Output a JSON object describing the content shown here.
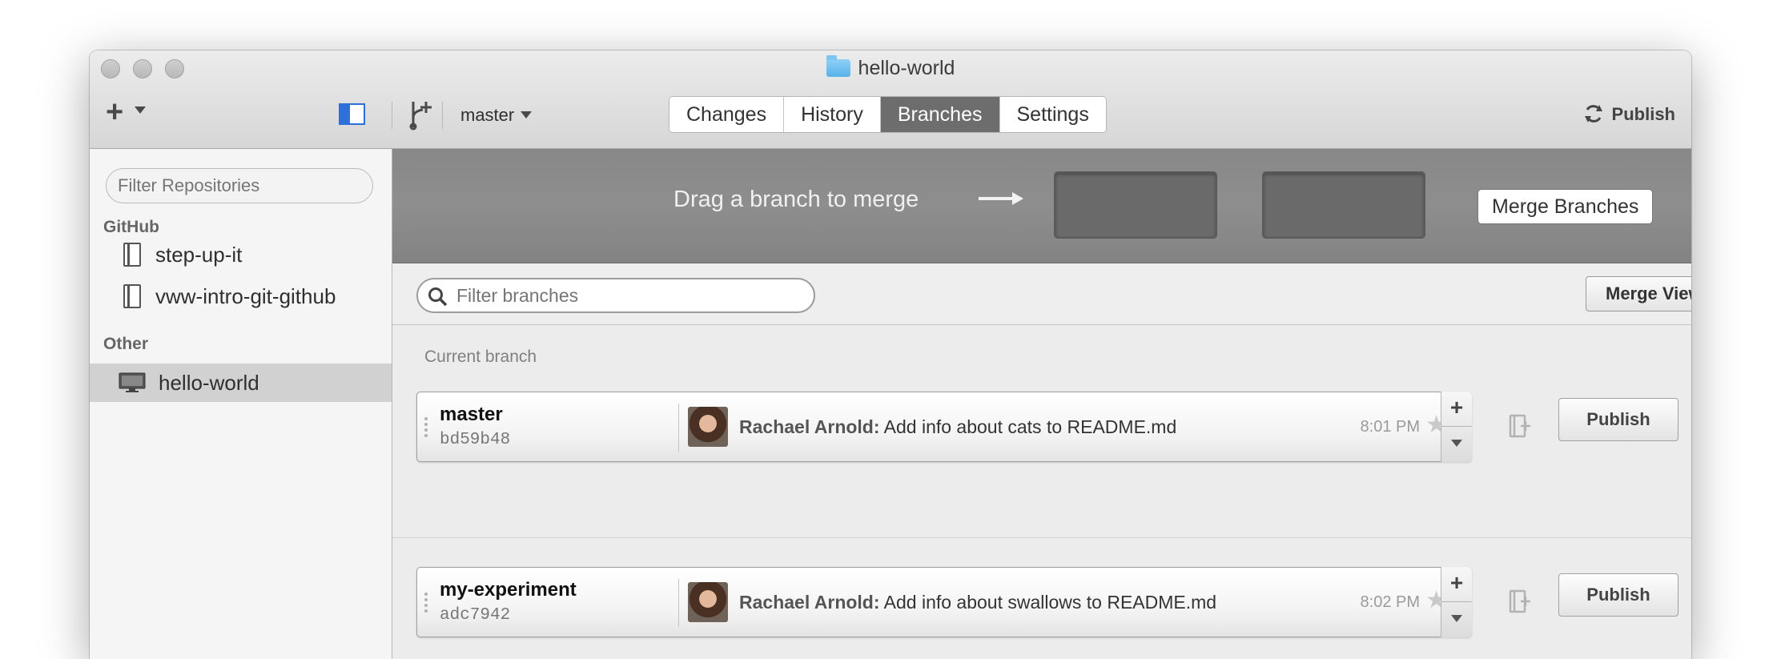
{
  "window": {
    "title": "hello-world"
  },
  "toolbar": {
    "branch_name": "master",
    "tabs": [
      {
        "label": "Changes",
        "active": false
      },
      {
        "label": "History",
        "active": false
      },
      {
        "label": "Branches",
        "active": true
      },
      {
        "label": "Settings",
        "active": false
      }
    ],
    "publish_label": "Publish"
  },
  "sidebar": {
    "filter_placeholder": "Filter Repositories",
    "groups": [
      {
        "label": "GitHub",
        "items": [
          "step-up-it",
          "vww-intro-git-github"
        ]
      },
      {
        "label": "Other",
        "items": [
          "hello-world"
        ]
      }
    ],
    "selected": "hello-world"
  },
  "merge": {
    "hint": "Drag a branch to merge",
    "button_label": "Merge Branches"
  },
  "branches": {
    "filter_placeholder": "Filter branches",
    "merge_view_label": "Merge View",
    "current_section_label": "Current branch",
    "rows": [
      {
        "name": "master",
        "sha": "bd59b48",
        "author": "Rachael Arnold:",
        "message": "Add info about cats to README.md",
        "time": "8:01 PM",
        "publish_label": "Publish"
      },
      {
        "name": "my-experiment",
        "sha": "adc7942",
        "author": "Rachael Arnold:",
        "message": "Add info about swallows to README.md",
        "time": "8:02 PM",
        "publish_label": "Publish"
      }
    ]
  },
  "colors": {
    "accent": "#2e6fd9",
    "active_tab": "#6d6d6d",
    "merge_banner": "#8a8a8a"
  },
  "icons": [
    "plus-icon",
    "sidebar-toggle-icon",
    "branch-add-icon",
    "sync-icon",
    "folder-icon",
    "repo-icon",
    "monitor-icon",
    "search-icon",
    "star-icon",
    "compare-icon"
  ]
}
